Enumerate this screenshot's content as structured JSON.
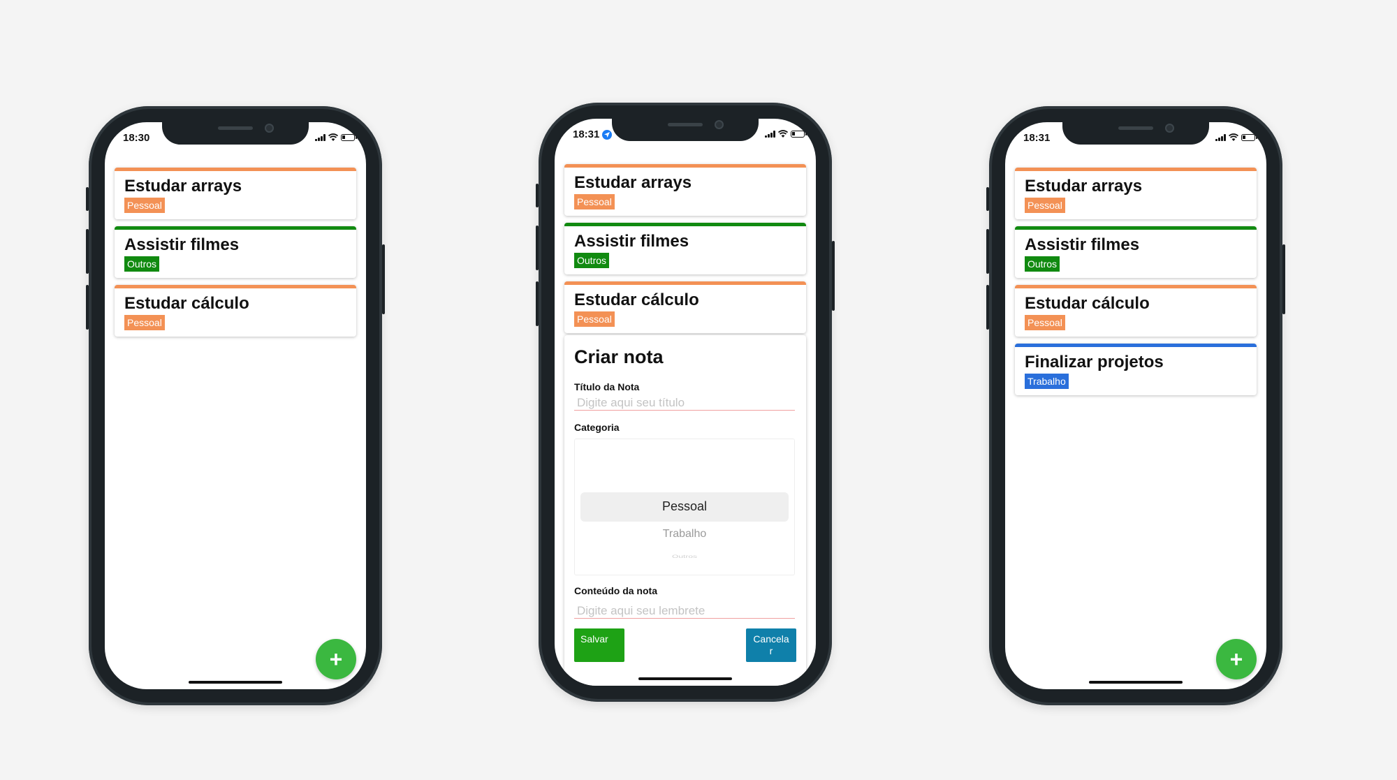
{
  "colors": {
    "pessoal": "#f39155",
    "outros": "#118a10",
    "trabalho": "#2a6fdb",
    "fab": "#3bb840",
    "save": "#1ea215",
    "cancel": "#0f80aa"
  },
  "phones": [
    {
      "status_time": "18:30",
      "notes": [
        {
          "title": "Estudar arrays",
          "category": "Pessoal"
        },
        {
          "title": "Assistir filmes",
          "category": "Outros"
        },
        {
          "title": "Estudar cálculo",
          "category": "Pessoal"
        }
      ],
      "fab_label": "+"
    },
    {
      "status_time": "18:31",
      "notes": [
        {
          "title": "Estudar arrays",
          "category": "Pessoal"
        },
        {
          "title": "Assistir filmes",
          "category": "Outros"
        },
        {
          "title": "Estudar cálculo",
          "category": "Pessoal"
        }
      ],
      "modal": {
        "title": "Criar nota",
        "title_label": "Título da Nota",
        "title_placeholder": "Digite aqui seu título",
        "category_label": "Categoria",
        "picker_options": [
          "Pessoal",
          "Trabalho",
          "Outros"
        ],
        "picker_selected": "Pessoal",
        "content_label": "Conteúdo da nota",
        "content_placeholder": "Digite aqui seu lembrete",
        "save_label": "Salvar",
        "cancel_label": "Cancelar"
      }
    },
    {
      "status_time": "18:31",
      "notes": [
        {
          "title": "Estudar arrays",
          "category": "Pessoal"
        },
        {
          "title": "Assistir filmes",
          "category": "Outros"
        },
        {
          "title": "Estudar cálculo",
          "category": "Pessoal"
        },
        {
          "title": "Finalizar projetos",
          "category": "Trabalho"
        }
      ],
      "fab_label": "+"
    }
  ]
}
